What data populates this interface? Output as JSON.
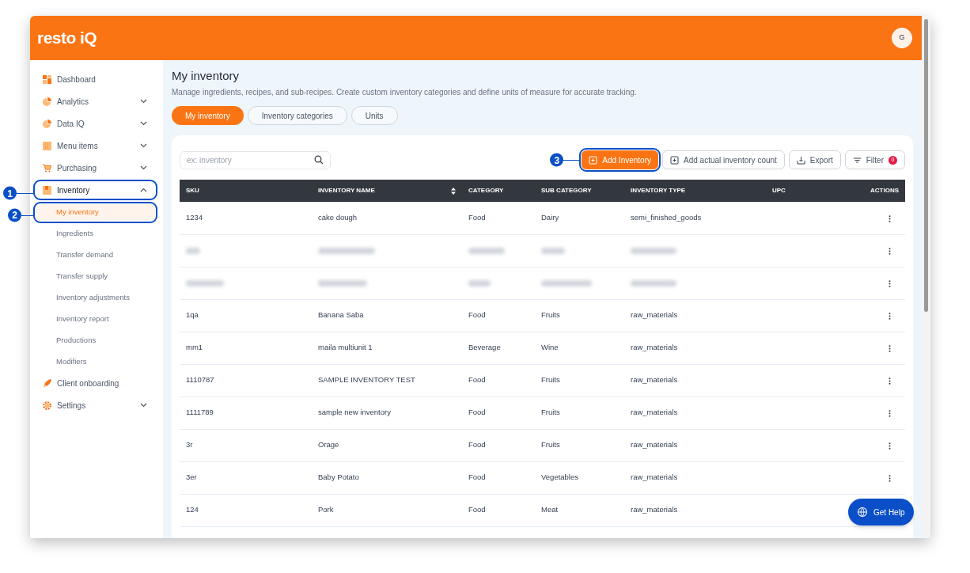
{
  "app": {
    "logo": "resto iQ",
    "avatar": "G"
  },
  "sidebar": {
    "items": [
      {
        "label": "Dashboard",
        "has_caret": false,
        "expanded": false,
        "selected": false
      },
      {
        "label": "Analytics",
        "has_caret": true,
        "expanded": false,
        "selected": false
      },
      {
        "label": "Data IQ",
        "has_caret": true,
        "expanded": false,
        "selected": false
      },
      {
        "label": "Menu items",
        "has_caret": true,
        "expanded": false,
        "selected": false
      },
      {
        "label": "Purchasing",
        "has_caret": true,
        "expanded": false,
        "selected": false
      },
      {
        "label": "Inventory",
        "has_caret": true,
        "expanded": true,
        "selected": false,
        "callout": "1",
        "children": [
          {
            "label": "My inventory",
            "selected": true,
            "callout": "2"
          },
          {
            "label": "Ingredients",
            "selected": false
          },
          {
            "label": "Transfer demand",
            "selected": false
          },
          {
            "label": "Transfer supply",
            "selected": false
          },
          {
            "label": "Inventory adjustments",
            "selected": false
          },
          {
            "label": "Inventory report",
            "selected": false
          },
          {
            "label": "Productions",
            "selected": false
          },
          {
            "label": "Modifiers",
            "selected": false
          }
        ]
      },
      {
        "label": "Client onboarding",
        "has_caret": false,
        "expanded": false,
        "selected": false
      },
      {
        "label": "Settings",
        "has_caret": true,
        "expanded": false,
        "selected": false
      }
    ]
  },
  "page": {
    "title": "My inventory",
    "subtitle": "Manage ingredients, recipes, and sub-recipes. Create custom inventory categories and define units of measure for accurate tracking."
  },
  "tabs": [
    {
      "label": "My inventory",
      "selected": true
    },
    {
      "label": "Inventory categories",
      "selected": false
    },
    {
      "label": "Units",
      "selected": false
    }
  ],
  "search": {
    "placeholder": "ex: inventory"
  },
  "toolbar": [
    {
      "label": "Add Inventory",
      "kind": "primary",
      "callout": "3"
    },
    {
      "label": "Add actual inventory count",
      "kind": "add"
    },
    {
      "label": "Export",
      "kind": "export"
    },
    {
      "label": "Filter",
      "kind": "filter",
      "badge": "0"
    }
  ],
  "table": {
    "columns": [
      {
        "label": "SKU",
        "sortable": false
      },
      {
        "label": "INVENTORY NAME",
        "sortable": true
      },
      {
        "label": "CATEGORY",
        "sortable": false
      },
      {
        "label": "SUB CATEGORY",
        "sortable": false
      },
      {
        "label": "INVENTORY TYPE",
        "sortable": false
      },
      {
        "label": "UPC",
        "sortable": false
      },
      {
        "label": "ACTIONS",
        "sortable": false
      }
    ],
    "rows": [
      {
        "redacted": false,
        "cells": [
          "1234",
          "cake dough",
          "Food",
          "Dairy",
          "semi_finished_goods",
          ""
        ]
      },
      {
        "redacted": true
      },
      {
        "redacted": true
      },
      {
        "redacted": false,
        "cells": [
          "1qa",
          "Banana Saba",
          "Food",
          "Fruits",
          "raw_materials",
          ""
        ]
      },
      {
        "redacted": false,
        "cells": [
          "mm1",
          "maila multiunit 1",
          "Beverage",
          "Wine",
          "raw_materials",
          ""
        ]
      },
      {
        "redacted": false,
        "cells": [
          "1110787",
          "SAMPLE INVENTORY TEST",
          "Food",
          "Fruits",
          "raw_materials",
          ""
        ]
      },
      {
        "redacted": false,
        "cells": [
          "1111789",
          "sample new inventory",
          "Food",
          "Fruits",
          "raw_materials",
          ""
        ]
      },
      {
        "redacted": false,
        "cells": [
          "3r",
          "Orage",
          "Food",
          "Fruits",
          "raw_materials",
          ""
        ]
      },
      {
        "redacted": false,
        "cells": [
          "3er",
          "Baby Potato",
          "Food",
          "Vegetables",
          "raw_materials",
          ""
        ]
      },
      {
        "redacted": false,
        "cells": [
          "124",
          "Pork",
          "Food",
          "Meat",
          "raw_materials",
          ""
        ]
      }
    ]
  },
  "help_button": {
    "label": "Get Help"
  }
}
